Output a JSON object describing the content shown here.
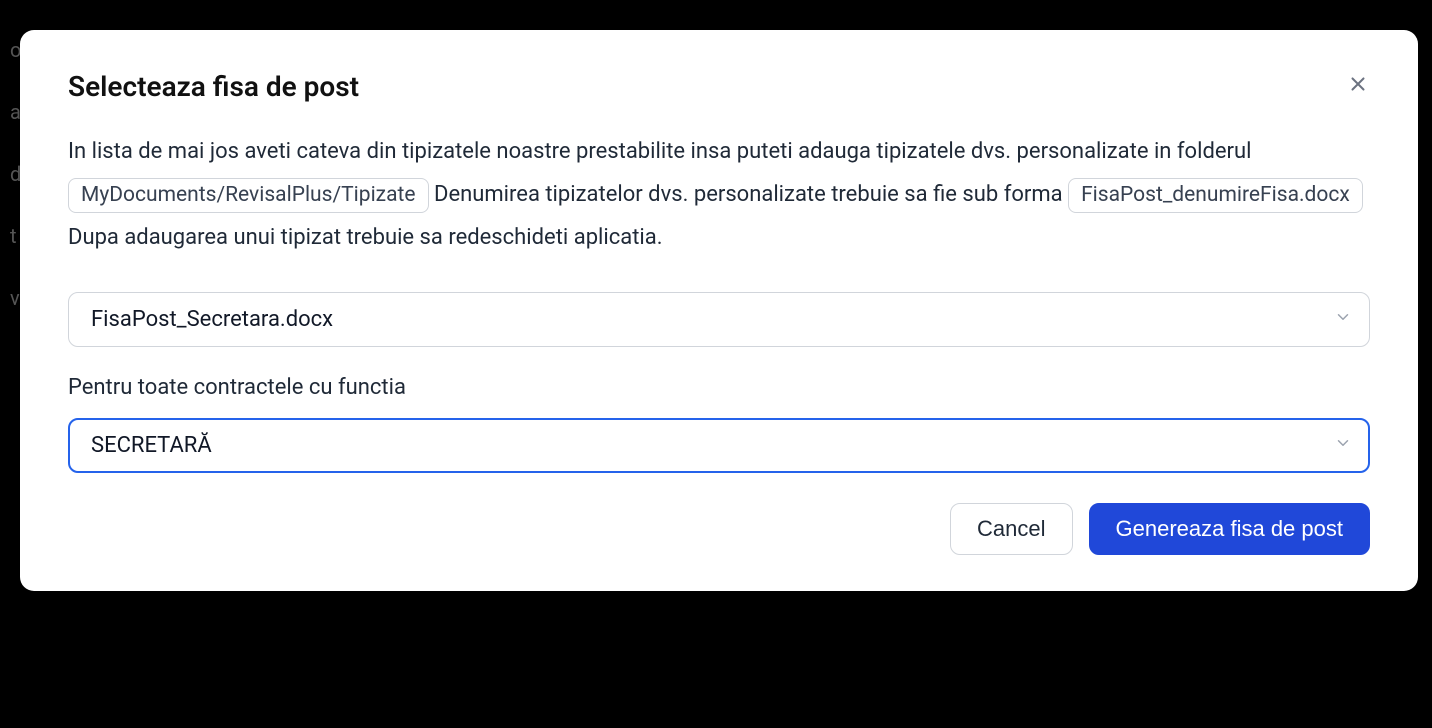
{
  "modal": {
    "title": "Selecteaza fisa de post",
    "description": {
      "part1": "In lista de mai jos aveti cateva din tipizatele noastre prestabilite insa puteti adauga tipizatele dvs. personalizate in folderul ",
      "chip1": "MyDocuments/RevisalPlus/Tipizate",
      "part2": " Denumirea tipizatelor dvs. personalizate trebuie sa fie sub forma ",
      "chip2": "FisaPost_denumireFisa.docx",
      "part3": " Dupa adaugarea unui tipizat trebuie sa redeschideti aplicatia."
    },
    "template_select": {
      "selected": "FisaPost_Secretara.docx"
    },
    "function_label": "Pentru toate contractele cu functia",
    "function_select": {
      "selected": "SECRETARĂ"
    },
    "buttons": {
      "cancel": "Cancel",
      "generate": "Genereaza fisa de post"
    }
  }
}
